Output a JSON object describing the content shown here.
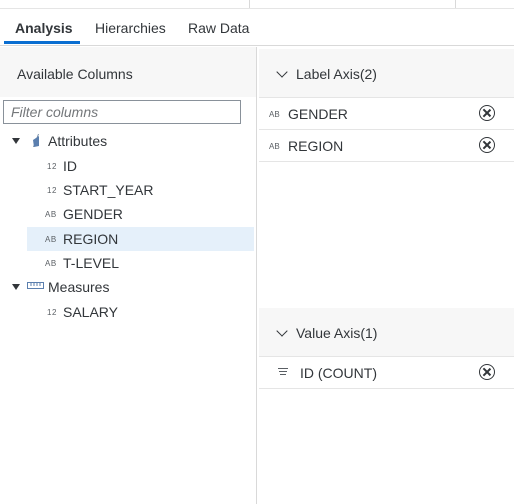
{
  "tabs": [
    {
      "label": "Analysis",
      "active": true
    },
    {
      "label": "Hierarchies",
      "active": false
    },
    {
      "label": "Raw Data",
      "active": false
    }
  ],
  "left_panel": {
    "title": "Available Columns",
    "filter_placeholder": "Filter columns",
    "groups": [
      {
        "label": "Attributes",
        "icon": "attribute-icon",
        "expanded": true,
        "items": [
          {
            "type": "12",
            "label": "ID"
          },
          {
            "type": "12",
            "label": "START_YEAR"
          },
          {
            "type": "AB",
            "label": "GENDER"
          },
          {
            "type": "AB",
            "label": "REGION",
            "selected": true
          },
          {
            "type": "AB",
            "label": "T-LEVEL"
          }
        ]
      },
      {
        "label": "Measures",
        "icon": "ruler-icon",
        "expanded": true,
        "items": [
          {
            "type": "12",
            "label": "SALARY"
          }
        ]
      }
    ]
  },
  "right_panel": {
    "label_axis": {
      "title": "Label Axis(2)",
      "items": [
        {
          "type": "AB",
          "label": "GENDER"
        },
        {
          "type": "AB",
          "label": "REGION"
        }
      ]
    },
    "value_axis": {
      "title": "Value Axis(1)",
      "items": [
        {
          "label": "ID (COUNT)"
        }
      ]
    }
  },
  "colors": {
    "accent": "#0a6ed1",
    "selected_row": "#e5f0fa",
    "header_bg": "#f7f7f7"
  }
}
